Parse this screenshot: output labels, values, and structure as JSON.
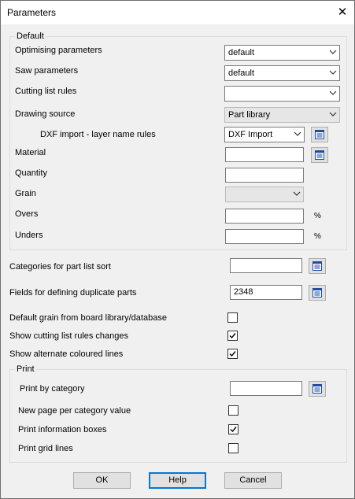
{
  "window": {
    "title": "Parameters",
    "close_glyph": "✕"
  },
  "default_group": {
    "title": "Default",
    "optimising": {
      "label": "Optimising parameters",
      "value": "default"
    },
    "saw": {
      "label": "Saw parameters",
      "value": "default"
    },
    "cutting_rules": {
      "label": "Cutting list rules",
      "value": ""
    },
    "drawing_source": {
      "label": "Drawing source",
      "value": "Part library"
    },
    "dxf_rules": {
      "label": "DXF import - layer name rules",
      "value": "DXF Import"
    },
    "material": {
      "label": "Material",
      "value": ""
    },
    "quantity": {
      "label": "Quantity",
      "value": ""
    },
    "grain": {
      "label": "Grain",
      "value": ""
    },
    "overs": {
      "label": "Overs",
      "value": "",
      "unit": "%"
    },
    "unders": {
      "label": "Unders",
      "value": "",
      "unit": "%"
    }
  },
  "categories_sort": {
    "label": "Categories for part list sort",
    "value": ""
  },
  "duplicate_fields": {
    "label": "Fields for defining duplicate parts",
    "value": "2348"
  },
  "checks": {
    "default_grain": {
      "label": "Default grain from board library/database",
      "checked": false
    },
    "show_rules_changes": {
      "label": "Show cutting list rules changes",
      "checked": true
    },
    "alt_lines": {
      "label": "Show alternate coloured lines",
      "checked": true
    }
  },
  "print_group": {
    "title": "Print",
    "by_category": {
      "label": "Print by category",
      "value": ""
    },
    "new_page": {
      "label": "New page per category value",
      "checked": false
    },
    "info_boxes": {
      "label": "Print information boxes",
      "checked": true
    },
    "grid_lines": {
      "label": "Print grid lines",
      "checked": false
    }
  },
  "buttons": {
    "ok": "OK",
    "help": "Help",
    "cancel": "Cancel"
  },
  "icons": {
    "dropdown": "chevron-down-icon",
    "picker": "list-picker-icon",
    "check": "checkmark-icon",
    "close": "close-icon"
  }
}
